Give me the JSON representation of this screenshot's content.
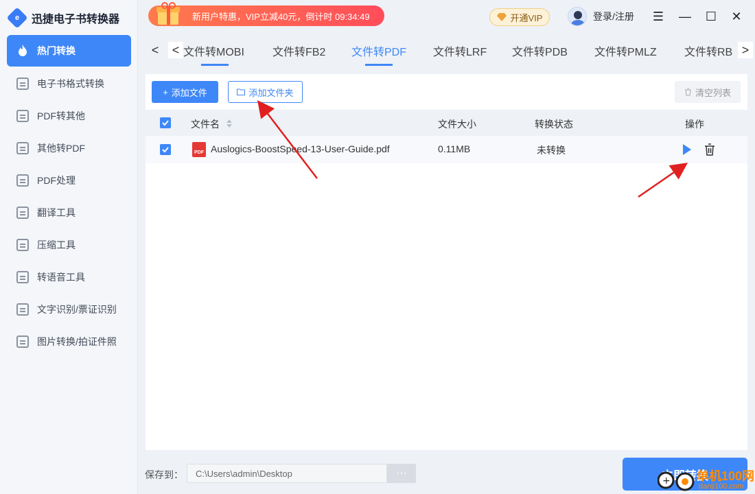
{
  "app": {
    "title": "迅捷电子书转换器",
    "logo_glyph": "e"
  },
  "sidebar": {
    "items": [
      {
        "label": "热门转换",
        "active": true,
        "icon": "flame-icon"
      },
      {
        "label": "电子书格式转换",
        "icon": "ebook-format-icon"
      },
      {
        "label": "PDF转其他",
        "icon": "pdf-to-other-icon"
      },
      {
        "label": "其他转PDF",
        "icon": "other-to-pdf-icon"
      },
      {
        "label": "PDF处理",
        "icon": "pdf-edit-icon"
      },
      {
        "label": "翻译工具",
        "icon": "translate-icon"
      },
      {
        "label": "压缩工具",
        "icon": "compress-icon"
      },
      {
        "label": "转语音工具",
        "icon": "audio-icon"
      },
      {
        "label": "文字识别/票证识别",
        "icon": "ocr-icon"
      },
      {
        "label": "图片转换/拍证件照",
        "icon": "image-icon"
      }
    ]
  },
  "topbar": {
    "promo": "新用户特惠，VIP立减40元，倒计时 09:34:49",
    "vip": "开通VIP",
    "login": "登录/注册",
    "menu_icon": "☰",
    "min_icon": "—",
    "max_icon": "☐",
    "close_icon": "✕"
  },
  "tabs": {
    "prev": "<",
    "next": ">",
    "items": [
      "文件转MOBI",
      "文件转FB2",
      "文件转PDF",
      "文件转LRF",
      "文件转PDB",
      "文件转PMLZ",
      "文件转RB"
    ],
    "active_index": 2
  },
  "toolbar": {
    "add_file": "添加文件",
    "add_file_glyph": "+",
    "add_folder": "添加文件夹",
    "clear": "清空列表"
  },
  "table": {
    "headers": {
      "name": "文件名",
      "size": "文件大小",
      "status": "转换状态",
      "action": "操作"
    },
    "rows": [
      {
        "name": "Auslogics-BoostSpeed-13-User-Guide.pdf",
        "size": "0.11MB",
        "status": "未转换",
        "checked": true
      }
    ],
    "pdf_badge": "PDF"
  },
  "footer": {
    "save_label": "保存到：",
    "save_path": "C:\\Users\\admin\\Desktop",
    "browse": "···",
    "convert": "立即转换"
  },
  "watermark": {
    "text": "单机100网",
    "sub": "danji100.com"
  },
  "colors": {
    "accent": "#3e87f8",
    "promo": "#ff4d5a",
    "annotation": "#e02020"
  }
}
